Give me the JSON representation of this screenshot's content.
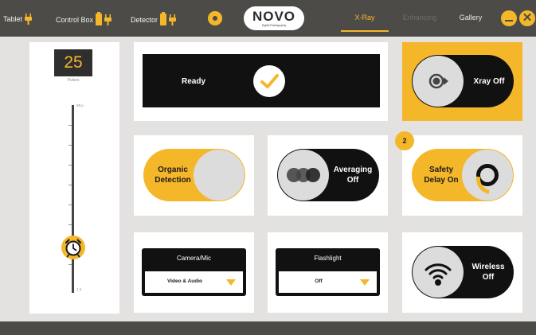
{
  "topbar": {
    "devices": [
      {
        "label": "Tablet",
        "icon": "plug-icon"
      },
      {
        "label": "Control Box",
        "icon": "battery-icon"
      },
      {
        "label": "Detector",
        "icon": "battery-icon"
      }
    ],
    "logo_main": "NOVO",
    "logo_sub": "Digital Radiography",
    "tabs": [
      "X-Ray",
      "Enhancing",
      "Gallery"
    ],
    "active_tab": "X-Ray",
    "close_glyph": "✕"
  },
  "slider": {
    "value": "25",
    "unit_label": "Pulses",
    "max_label": "99 p",
    "min_label": "1 p"
  },
  "ready": {
    "label": "Ready"
  },
  "xray": {
    "label": "Xray Off"
  },
  "organic": {
    "line1": "Organic",
    "line2": "Detection"
  },
  "averaging": {
    "line1": "Averaging",
    "line2": "Off"
  },
  "safety": {
    "line1": "Safety",
    "line2": "Delay On",
    "badge": "2"
  },
  "camera": {
    "title": "Camera/Mic",
    "value": "Video & Audio"
  },
  "flashlight": {
    "title": "Flashlight",
    "value": "Off"
  },
  "wireless": {
    "line1": "Wireless",
    "line2": "Off"
  },
  "colors": {
    "accent": "#f5b72a",
    "topbar": "#4d4b48",
    "background": "#e3e2e0",
    "dark": "#111111"
  }
}
